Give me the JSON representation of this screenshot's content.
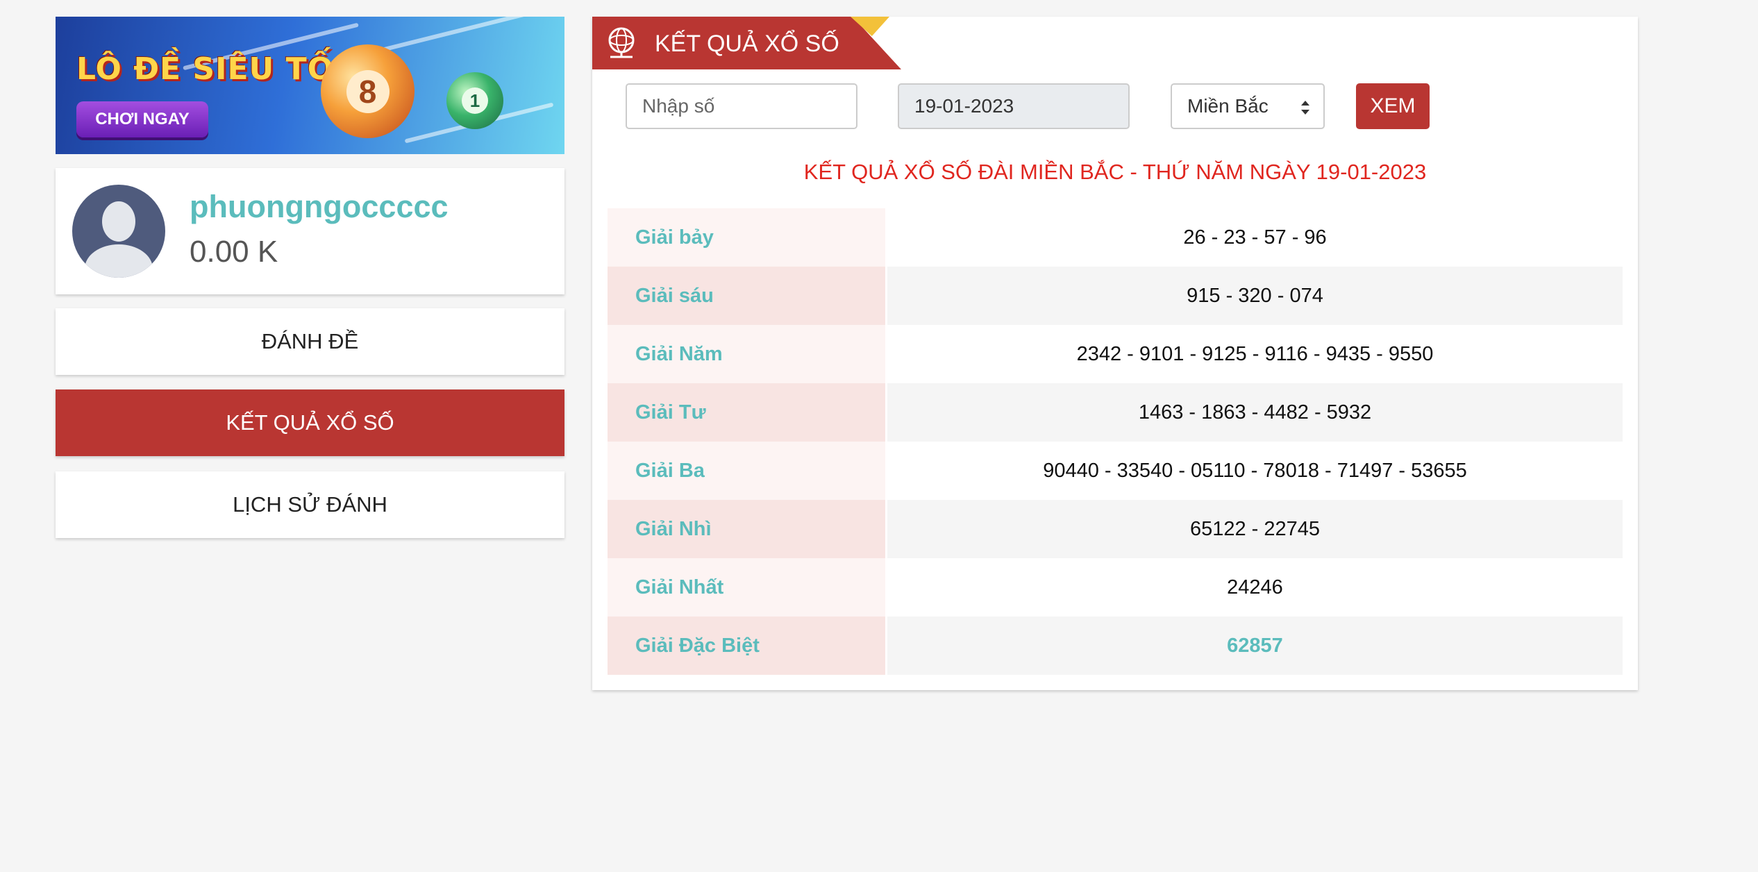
{
  "banner": {
    "title": "LÔ ĐỀ SIÊU TỐC",
    "cta_label": "CHƠI NGAY",
    "ball_big": "8",
    "ball_small": "1"
  },
  "profile": {
    "username": "phuongngoccccc",
    "balance": "0.00 K"
  },
  "nav": {
    "bet": "ĐÁNH ĐỀ",
    "results": "KẾT QUẢ XỔ SỐ",
    "history": "LỊCH SỬ ĐÁNH"
  },
  "panel": {
    "title": "KẾT QUẢ XỔ SỐ",
    "search_placeholder": "Nhập số",
    "date_value": "19-01-2023",
    "region_selected": "Miền Bắc",
    "submit_label": "XEM",
    "result_heading": "KẾT QUẢ XỔ SỐ ĐÀI MIỀN BẮC - THỨ NĂM NGÀY 19-01-2023"
  },
  "results": [
    {
      "label": "Giải bảy",
      "value": "26 - 23 - 57 - 96"
    },
    {
      "label": "Giải sáu",
      "value": "915 - 320 - 074"
    },
    {
      "label": "Giải Năm",
      "value": "2342 - 9101 - 9125 - 9116 - 9435 - 9550"
    },
    {
      "label": "Giải Tư",
      "value": "1463 - 1863 - 4482 - 5932"
    },
    {
      "label": "Giải Ba",
      "value": "90440 - 33540 - 05110 - 78018 - 71497 - 53655"
    },
    {
      "label": "Giải Nhì",
      "value": "65122 - 22745"
    },
    {
      "label": "Giải Nhất",
      "value": "24246"
    },
    {
      "label": "Giải Đặc Biệt",
      "value": "62857"
    }
  ],
  "colors": {
    "accent_red": "#b93632",
    "teal": "#5bbcbc",
    "heading_red": "#e0261f"
  }
}
